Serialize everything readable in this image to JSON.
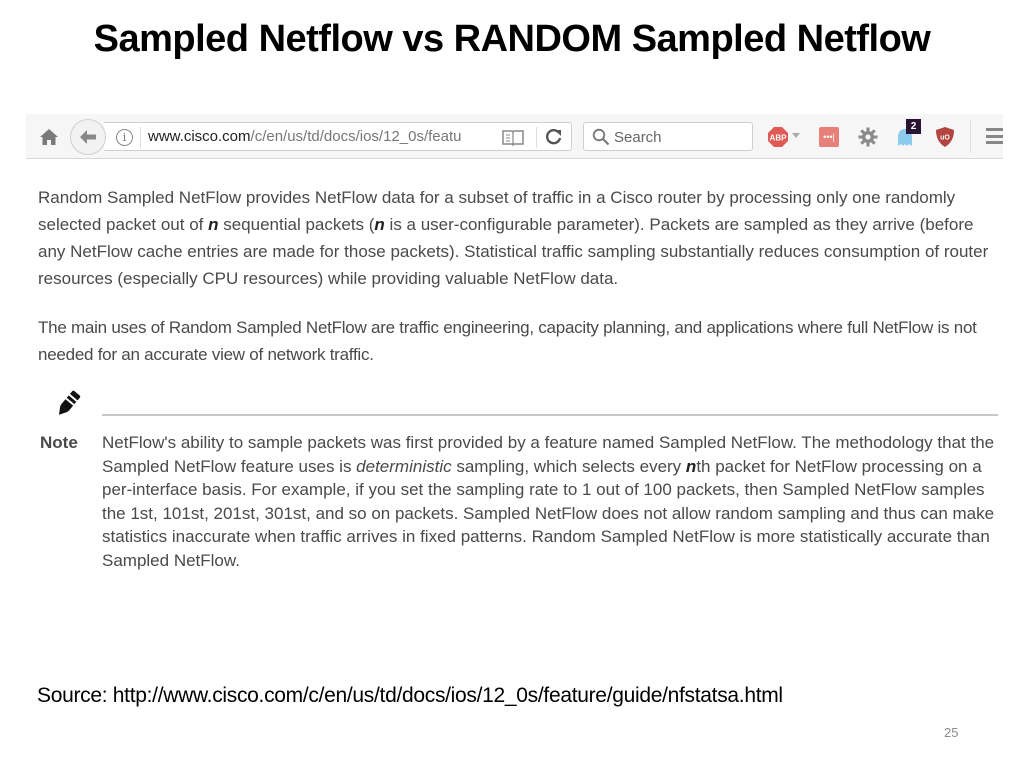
{
  "slide": {
    "title": "Sampled Netflow vs RANDOM Sampled Netflow",
    "source": "Source: http://www.cisco.com/c/en/us/td/docs/ios/12_0s/feature/guide/nfstatsa.html",
    "page_number": "25"
  },
  "browser": {
    "url_domain": "www.cisco.com",
    "url_path": "/c/en/us/td/docs/ios/12_0s/featu",
    "search_placeholder": "Search",
    "icons": {
      "home": "home-icon",
      "back": "back-arrow-icon",
      "info": "info-icon",
      "reader": "reader-view-icon",
      "reload": "reload-icon",
      "search": "search-icon",
      "adblock": "adblock-plus-icon",
      "lastpass": "lastpass-icon",
      "settings": "gear-icon",
      "ghostery": "ghostery-icon",
      "ublock": "ublock-origin-icon",
      "menu": "hamburger-menu-icon"
    },
    "ghostery_badge": "2",
    "info_glyph": "i",
    "reload_glyph": "↻",
    "lastpass_glyph": "•••|",
    "abp_glyph": "ABP",
    "ublock_glyph": "uO"
  },
  "article": {
    "para1": {
      "p1": "Random Sampled NetFlow provides NetFlow data for a subset of traffic in a Cisco router by processing only one randomly selected packet out of ",
      "n1": "n",
      "p2": " sequential packets (",
      "n2": "n",
      "p3": " is a user-configurable parameter). Packets are sampled as they arrive (before any NetFlow cache entries are made for those packets). Statistical traffic sampling substantially reduces consumption of router resources (especially CPU resources) while providing valuable NetFlow data."
    },
    "para2": "The main uses of Random Sampled NetFlow are traffic engineering, capacity planning, and applications where full NetFlow is not needed for an accurate view of network traffic.",
    "note": {
      "label": "Note",
      "t1": "NetFlow's ability to sample packets was first provided by a feature named Sampled NetFlow. The methodology that the Sampled NetFlow feature uses is ",
      "em": "deterministic",
      "t2": " sampling, which selects every ",
      "n": "n",
      "t3": "th packet for NetFlow processing on a per-interface basis. For example, if you set the sampling rate to 1 out of 100 packets, then Sampled NetFlow samples the 1st, 101st, 201st, 301st, and so on packets. Sampled NetFlow does not allow random sampling and thus can make statistics inaccurate when traffic arrives in fixed patterns. Random Sampled NetFlow is more statistically accurate than Sampled NetFlow."
    }
  },
  "colors": {
    "toolbar_bg": "#f6f6f6",
    "body_text": "#4a4a4a",
    "abp_red": "#e05a55",
    "lastpass_red": "#e8807a",
    "ghostery_blue": "#7fc3e8",
    "ublock_red": "#b0463f",
    "badge_bg": "#2a1433"
  }
}
